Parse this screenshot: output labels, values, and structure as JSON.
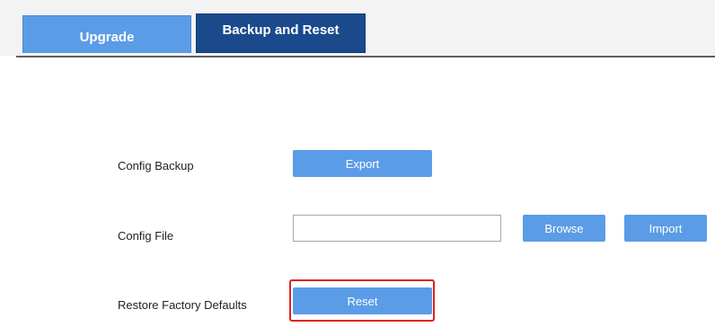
{
  "tabs": [
    {
      "label": "Upgrade",
      "active": false
    },
    {
      "label": "Backup and Reset",
      "active": true
    }
  ],
  "rows": {
    "config_backup": {
      "label": "Config Backup",
      "button_label": "Export"
    },
    "config_file": {
      "label": "Config File",
      "file_value": "",
      "browse_label": "Browse",
      "import_label": "Import"
    },
    "restore_defaults": {
      "label": "Restore Factory Defaults",
      "button_label": "Reset"
    }
  },
  "colors": {
    "tab_inactive": "#5b9ce6",
    "tab_active": "#1b4a8c",
    "button": "#5b9ce6",
    "highlight": "#e02020"
  }
}
